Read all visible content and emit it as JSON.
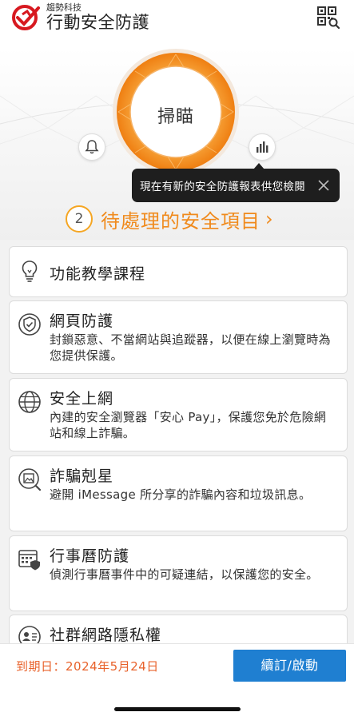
{
  "header": {
    "company": "趨勢科技",
    "app_name": "行動安全防護",
    "logo_icon": "trend-micro-logo-icon",
    "qr_icon": "qr-scan-icon"
  },
  "hero": {
    "scan_label": "掃瞄",
    "bell_icon": "bell-icon",
    "stats_icon": "bar-chart-icon",
    "tooltip_text": "現在有新的安全防護報表供您檢閱",
    "pending_count": "2",
    "pending_title": "待處理的安全項目",
    "pending_chevron": "›"
  },
  "features": [
    {
      "icon": "lightbulb-icon",
      "title": "功能教學課程",
      "desc": ""
    },
    {
      "icon": "shield-check-icon",
      "title": "網頁防護",
      "desc": "封鎖惡意、不當網站與追蹤器，以便在線上瀏覽時為您提供保護。"
    },
    {
      "icon": "globe-icon",
      "title": "安全上網",
      "desc": "內建的安全瀏覽器「安心 Pay」，保護您免於危險網站和線上詐騙。"
    },
    {
      "icon": "image-search-icon",
      "title": "詐騙剋星",
      "desc": "避開 iMessage 所分享的詐騙內容和垃圾訊息。"
    },
    {
      "icon": "calendar-shield-icon",
      "title": "行事曆防護",
      "desc": "偵測行事曆事件中的可疑連結，以保護您的安全。"
    },
    {
      "icon": "id-card-icon",
      "title": "社群網路隱私權",
      "desc": ""
    }
  ],
  "footer": {
    "expiry_text": "到期日：2024年5月24日",
    "renew_label": "續訂/啟動"
  },
  "colors": {
    "accent_orange": "#f08a1c",
    "expiry_red": "#e8612a",
    "button_blue": "#1f7fd1",
    "tooltip_bg": "#1e1e1e"
  }
}
